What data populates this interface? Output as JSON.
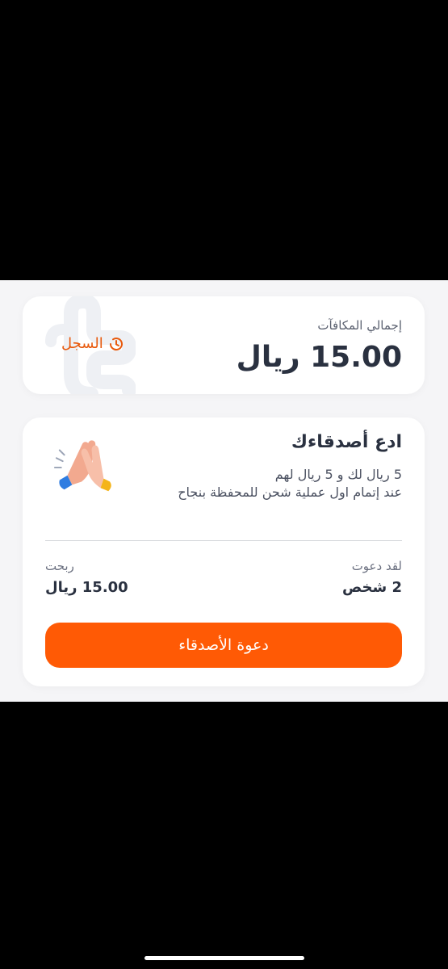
{
  "rewards": {
    "label": "إجمالي المكافآت",
    "amount": "15.00 ريال",
    "history_label": "السجل"
  },
  "invite": {
    "title": "ادع أصدقاءك",
    "desc_line1": "5 ريال لك و 5 ريال لهم",
    "desc_line2": "عند إتمام اول عملية شحن للمحفظة بنجاح",
    "invited_label": "لقد دعوت",
    "invited_value": "2 شخص",
    "earned_label": "ربحت",
    "earned_value": "15.00 ريال",
    "button_label": "دعوة الأصدقاء"
  },
  "colors": {
    "accent": "#ff5a05",
    "history": "#e8590c",
    "text_dark": "#2a3140"
  }
}
